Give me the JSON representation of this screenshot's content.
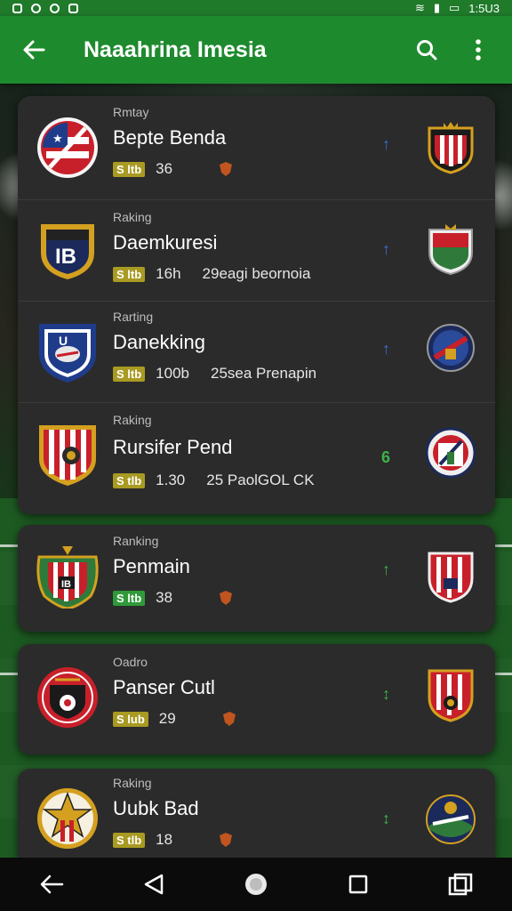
{
  "status": {
    "time": "1:5U3"
  },
  "appbar": {
    "title": "Naaahrina Imesia",
    "back_icon": "arrow-left-icon",
    "search_icon": "search-icon",
    "more_icon": "more-vert-icon"
  },
  "accent": "#1e8a2e",
  "teams": [
    {
      "label": "Rmtay",
      "name": "Bepte Benda",
      "badge": "S ltb",
      "value": "36",
      "note": "",
      "trend": "↑",
      "trend_color": "#3a6fd8",
      "badge_color": "yellow"
    },
    {
      "label": "Raking",
      "name": "Daemkuresi",
      "badge": "S ltb",
      "value": "16h",
      "note": "29eagi beornoia",
      "trend": "↑",
      "trend_color": "#3a6fd8",
      "badge_color": "yellow"
    },
    {
      "label": "Rarting",
      "name": "Danekking",
      "badge": "S ltb",
      "value": "100b",
      "note": "25sea Prenapin",
      "trend": "↑",
      "trend_color": "#3a6fd8",
      "badge_color": "yellow"
    },
    {
      "label": "Raking",
      "name": "Rursifer Pend",
      "badge": "S tlb",
      "value": "1.30",
      "note": "25 PaolGOL CK",
      "trend": "6",
      "trend_color": "#3cb24a",
      "badge_color": "yellow"
    },
    {
      "label": "Ranking",
      "name": "Penmain",
      "badge": "S ltb",
      "value": "38",
      "note": "",
      "trend": "↑",
      "trend_color": "#3cb24a",
      "badge_color": "green"
    },
    {
      "label": "Oadro",
      "name": "Panser Cutl",
      "badge": "S lub",
      "value": "29",
      "note": "",
      "trend": "↕",
      "trend_color": "#3cb24a",
      "badge_color": "yellow"
    },
    {
      "label": "Raking",
      "name": "Uubk Bad",
      "badge": "S tlb",
      "value": "18",
      "note": "",
      "trend": "↕",
      "trend_color": "#3cb24a",
      "badge_color": "yellow"
    }
  ],
  "navbar": {
    "icons": [
      "back-icon",
      "home-triangle-icon",
      "home-circle-icon",
      "recents-square-icon",
      "screenshot-icon"
    ]
  }
}
